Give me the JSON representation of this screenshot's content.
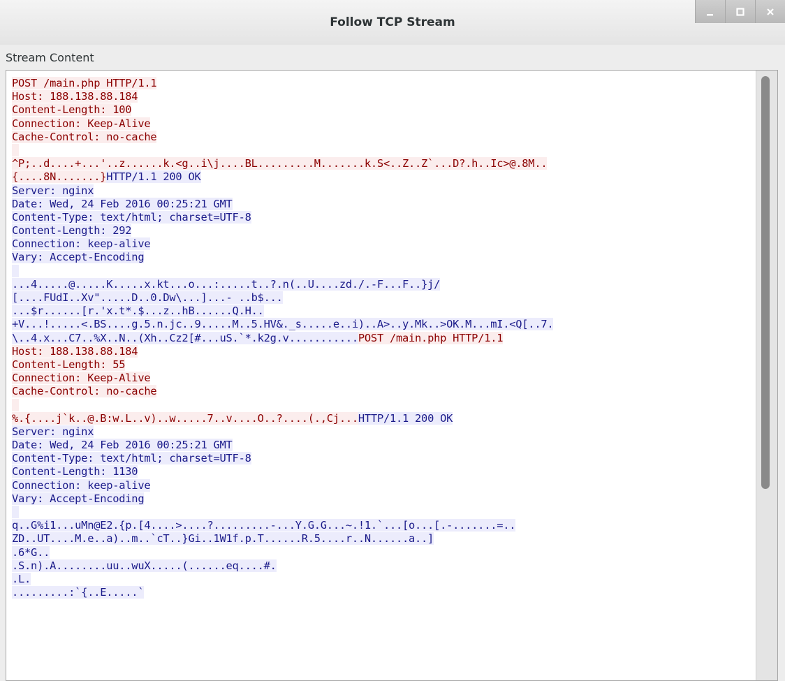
{
  "window": {
    "title": "Follow TCP Stream",
    "buttons": [
      "minimize",
      "maximize",
      "close"
    ]
  },
  "section_label": "Stream Content",
  "colors": {
    "client_bg": "#fbeded",
    "client_fg": "#8b0000",
    "server_bg": "#ececfc",
    "server_fg": "#1b1b8a"
  },
  "scrollbar": {
    "thumb_start_fraction": 0.0,
    "thumb_visible_fraction": 0.69
  },
  "stream_lines": [
    [
      {
        "t": "POST /main.php HTTP/1.1",
        "d": "c"
      }
    ],
    [
      {
        "t": "Host: 188.138.88.184",
        "d": "c"
      }
    ],
    [
      {
        "t": "Content-Length: 100",
        "d": "c"
      }
    ],
    [
      {
        "t": "Connection: Keep-Alive",
        "d": "c"
      }
    ],
    [
      {
        "t": "Cache-Control: no-cache",
        "d": "c"
      }
    ],
    [
      {
        "t": "",
        "d": "c"
      }
    ],
    [
      {
        "t": "^P;..d....+...'..z......k.<g..i\\j....BL.........M.......k.S<..Z..Z`...D?.h..Ic>@.8M..",
        "d": "c"
      }
    ],
    [
      {
        "t": "{....8N.......}",
        "d": "c"
      },
      {
        "t": "HTTP/1.1 200 OK",
        "d": "s"
      }
    ],
    [
      {
        "t": "Server: nginx",
        "d": "s"
      }
    ],
    [
      {
        "t": "Date: Wed, 24 Feb 2016 00:25:21 GMT",
        "d": "s"
      }
    ],
    [
      {
        "t": "Content-Type: text/html; charset=UTF-8",
        "d": "s"
      }
    ],
    [
      {
        "t": "Content-Length: 292",
        "d": "s"
      }
    ],
    [
      {
        "t": "Connection: keep-alive",
        "d": "s"
      }
    ],
    [
      {
        "t": "Vary: Accept-Encoding",
        "d": "s"
      }
    ],
    [
      {
        "t": "",
        "d": "s"
      }
    ],
    [
      {
        "t": "...4.....@.....K.....x.kt...o...:.....t..?.n(..U....zd./.-F...F..}j/",
        "d": "s"
      }
    ],
    [
      {
        "t": "[....FUdI..Xv\".....D..0.Dw\\...]...- ..b$...",
        "d": "s"
      }
    ],
    [
      {
        "t": "...$r......[r.'x.t*.$...z..hB......Q.H..",
        "d": "s"
      }
    ],
    [
      {
        "t": "+V...!.....<.BS....g.5.n.jc..9.....M..5.HV&._s.....e..i)..A>..y.Mk..>OK.M...mI.<Q[..7.",
        "d": "s"
      }
    ],
    [
      {
        "t": "\\..4.x...C7..%X..N..(Xh..Cz2[#...uS.`*.k2g.v...........",
        "d": "s"
      },
      {
        "t": "POST /main.php HTTP/1.1",
        "d": "c"
      }
    ],
    [
      {
        "t": "Host: 188.138.88.184",
        "d": "c"
      }
    ],
    [
      {
        "t": "Content-Length: 55",
        "d": "c"
      }
    ],
    [
      {
        "t": "Connection: Keep-Alive",
        "d": "c"
      }
    ],
    [
      {
        "t": "Cache-Control: no-cache",
        "d": "c"
      }
    ],
    [
      {
        "t": "",
        "d": "c"
      }
    ],
    [
      {
        "t": "%.{....j`k..@.B:w.L..v)..w.....7..v....O..?....(.,Cj...",
        "d": "c"
      },
      {
        "t": "HTTP/1.1 200 OK",
        "d": "s"
      }
    ],
    [
      {
        "t": "Server: nginx",
        "d": "s"
      }
    ],
    [
      {
        "t": "Date: Wed, 24 Feb 2016 00:25:21 GMT",
        "d": "s"
      }
    ],
    [
      {
        "t": "Content-Type: text/html; charset=UTF-8",
        "d": "s"
      }
    ],
    [
      {
        "t": "Content-Length: 1130",
        "d": "s"
      }
    ],
    [
      {
        "t": "Connection: keep-alive",
        "d": "s"
      }
    ],
    [
      {
        "t": "Vary: Accept-Encoding",
        "d": "s"
      }
    ],
    [
      {
        "t": "",
        "d": "s"
      }
    ],
    [
      {
        "t": "q..G%i1...uMn@E2.{p.[4....>....?.........-...Y.G.G...~.!1.`...[o...[.-.......=..",
        "d": "s"
      }
    ],
    [
      {
        "t": "ZD..UT....M.e..a)..m..`cT..}Gi..1W1f.p.T......R.5....r..N......a..]",
        "d": "s"
      }
    ],
    [
      {
        "t": ".6*G..",
        "d": "s"
      }
    ],
    [
      {
        "t": ".S.n).A........uu..wuX.....(......eq....#.",
        "d": "s"
      }
    ],
    [
      {
        "t": ".L.",
        "d": "s"
      }
    ],
    [
      {
        "t": ".........:`{..E.....`",
        "d": "s"
      }
    ]
  ]
}
